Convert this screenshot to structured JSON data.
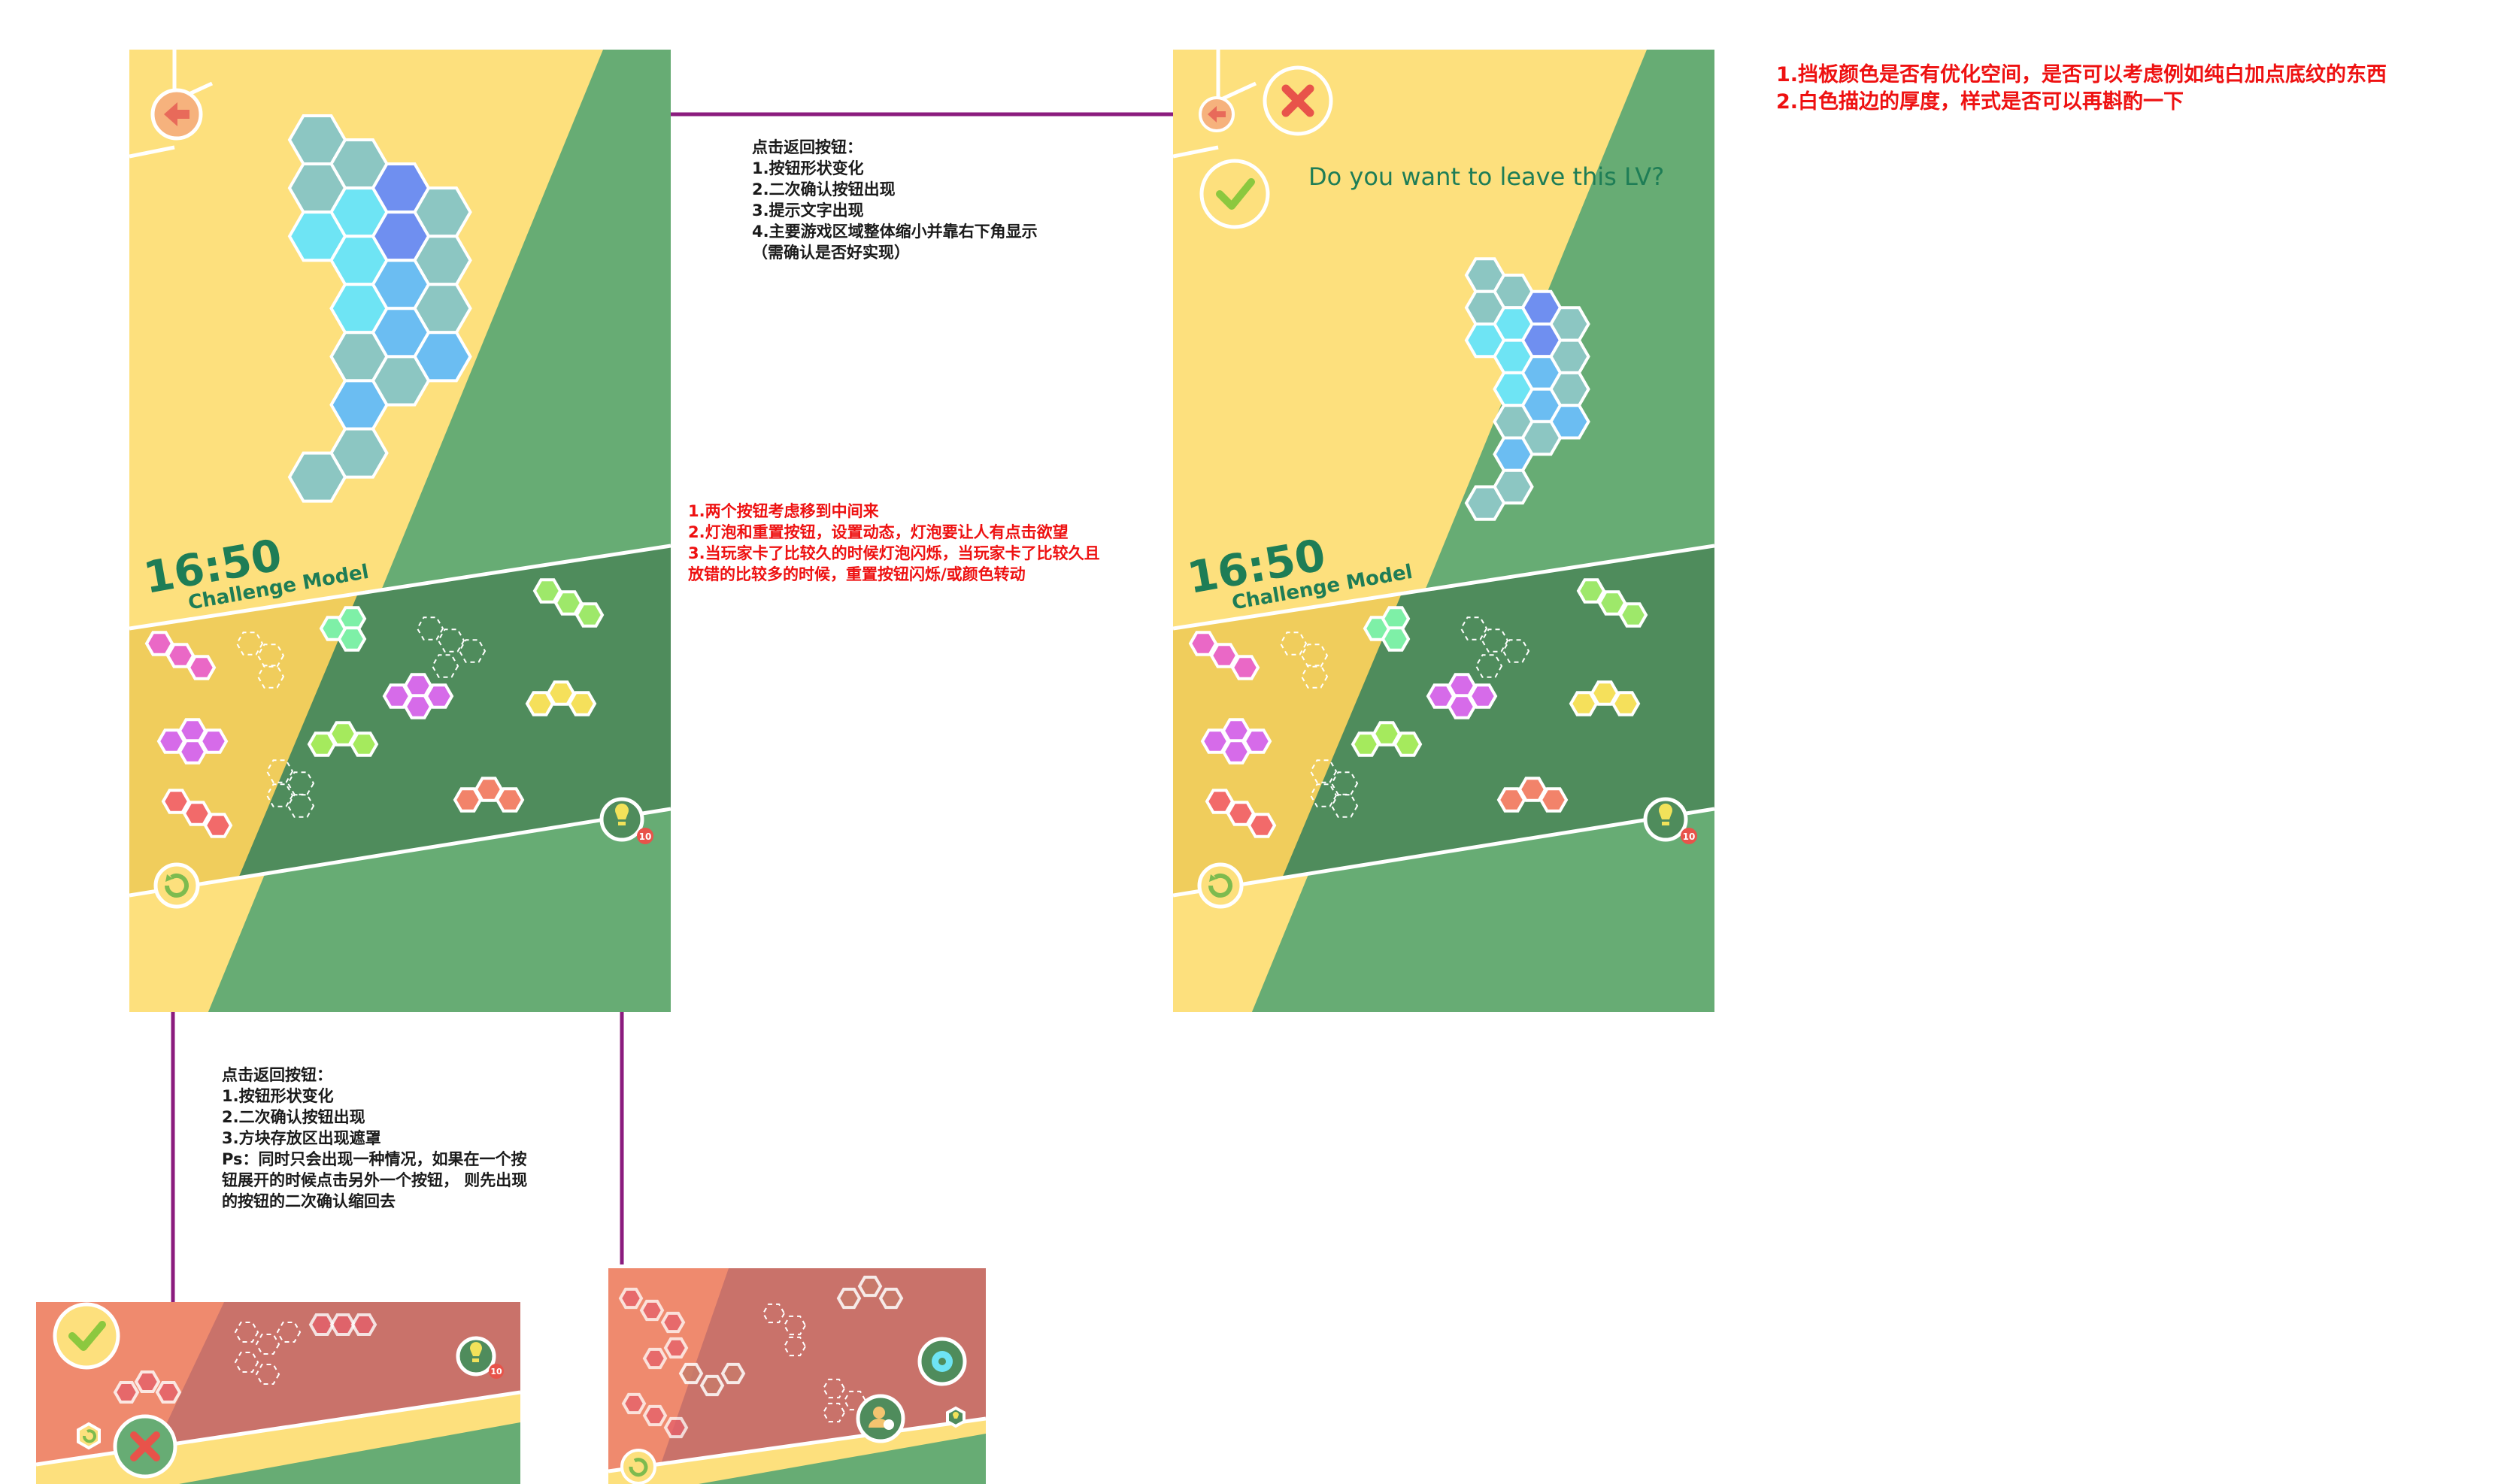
{
  "screens": {
    "main": {
      "timer": "16:50",
      "mode": "Challenge Model"
    },
    "confirm": {
      "timer": "16:50",
      "mode": "Challenge Model",
      "prompt": "Do you want to leave this LV?"
    }
  },
  "hint_badge": "10",
  "colors": {
    "yellow": "#fde07d",
    "green": "#67ac74",
    "dark_green": "#4f8c5c",
    "blue": "#6f8ff0",
    "cyan": "#6ee4f4",
    "line": "#8b1c7e",
    "alert": "#ee1111"
  },
  "notes": {
    "back_button": "点击返回按钮：\n1.按钮形状变化\n2.二次确认按钮出现\n3.提示文字出现\n4.主要游戏区域整体缩小并靠右下角显示\n（需确认是否好实现）",
    "buttons_feedback": "1.两个按钮考虑移到中间来\n2.灯泡和重置按钮，设置动态，灯泡要让人有点击欲望\n3.当玩家卡了比较久的时候灯泡闪烁，当玩家卡了比较久且\n放错的比较多的时候，重置按钮闪烁/或颜色转动",
    "top_right": "1.挡板颜色是否有优化空间，是否可以考虑例如纯白加点底纹的东西\n2.白色描边的厚度，样式是否可以再斟酌一下",
    "reset_button": "点击返回按钮：\n1.按钮形状变化\n2.二次确认按钮出现\n3.方块存放区出现遮罩\nPs：同时只会出现一种情况，如果在一个按\n钮展开的时候点击另外一个按钮， 则先出现\n的按钮的二次确认缩回去"
  },
  "icons": [
    "back-arrow-icon",
    "close-x-icon",
    "check-icon",
    "reset-icon",
    "lightbulb-icon",
    "share-icon",
    "user-icon"
  ]
}
